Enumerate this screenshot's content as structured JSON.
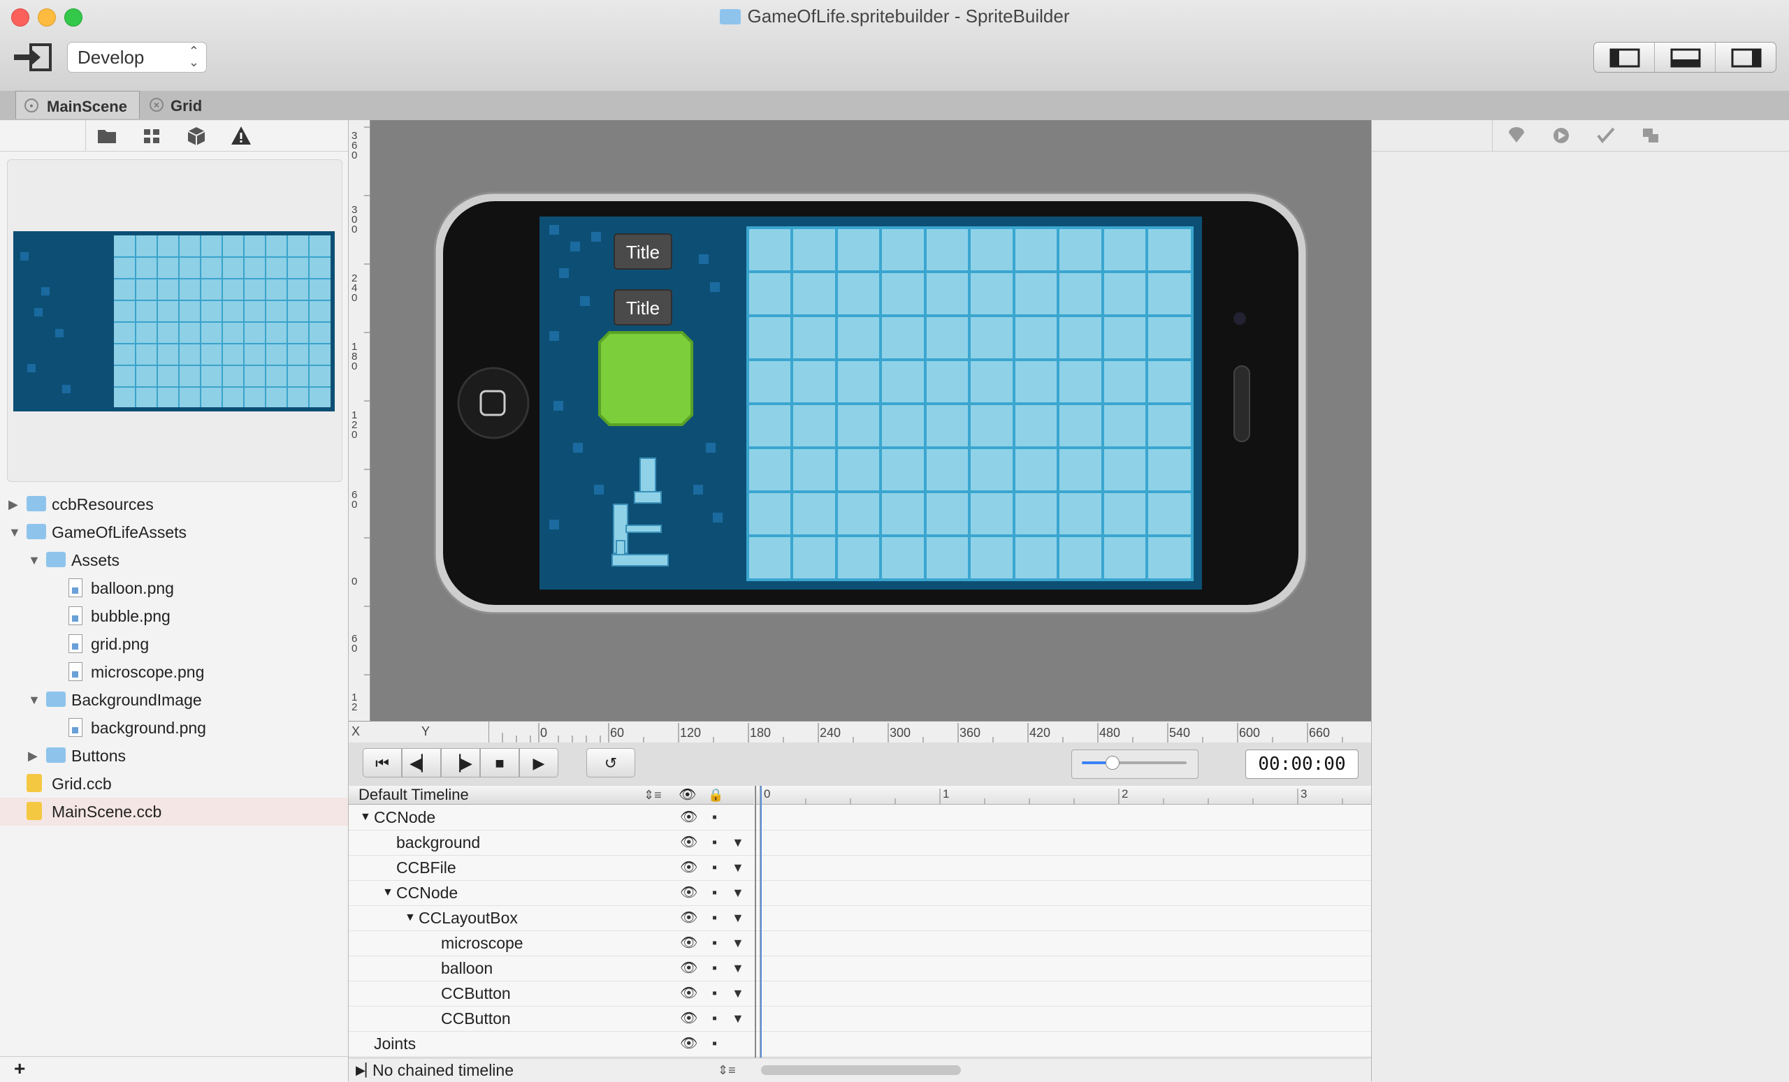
{
  "window": {
    "title": "GameOfLife.spritebuilder - SpriteBuilder"
  },
  "toolbar": {
    "mode_select": "Develop",
    "view_segments": [
      "left-panel-toggle",
      "bottom-panel-toggle",
      "right-panel-toggle"
    ]
  },
  "tabs": [
    {
      "label": "MainScene"
    },
    {
      "label": "Grid"
    }
  ],
  "left_toolbar_icons": [
    "folder-icon",
    "grid-icon",
    "cube-icon",
    "warning-icon"
  ],
  "file_tree": [
    {
      "label": "ccbResources",
      "type": "folder",
      "expanded": false,
      "depth": 0
    },
    {
      "label": "GameOfLifeAssets",
      "type": "folder",
      "expanded": true,
      "depth": 0
    },
    {
      "label": "Assets",
      "type": "folder",
      "expanded": true,
      "depth": 1
    },
    {
      "label": "balloon.png",
      "type": "image",
      "depth": 2
    },
    {
      "label": "bubble.png",
      "type": "image",
      "depth": 2
    },
    {
      "label": "grid.png",
      "type": "image",
      "depth": 2
    },
    {
      "label": "microscope.png",
      "type": "image",
      "depth": 2
    },
    {
      "label": "BackgroundImage",
      "type": "folder",
      "expanded": true,
      "depth": 1
    },
    {
      "label": "background.png",
      "type": "image",
      "depth": 2
    },
    {
      "label": "Buttons",
      "type": "folder",
      "expanded": false,
      "depth": 1
    },
    {
      "label": "Grid.ccb",
      "type": "ccb",
      "depth": 0
    },
    {
      "label": "MainScene.ccb",
      "type": "ccb",
      "depth": 0,
      "selected": true
    }
  ],
  "left_bottom": {
    "add_label": "+"
  },
  "canvas": {
    "buttons": [
      "Title",
      "Title"
    ],
    "vruler_labels": [
      "360",
      "300",
      "240",
      "180",
      "120",
      "60",
      "0",
      "60",
      "12"
    ],
    "hruler_x": "X",
    "hruler_y": "Y",
    "hruler_labels": [
      "0",
      "60",
      "120",
      "180",
      "240",
      "300",
      "360",
      "420",
      "480",
      "540",
      "600",
      "660"
    ]
  },
  "playback": {
    "buttons": [
      "go-to-start",
      "step-back",
      "step-forward",
      "stop",
      "play",
      "loop"
    ],
    "time": "00:00:00"
  },
  "timeline": {
    "name": "Default Timeline",
    "scale_labels": [
      "0",
      "1",
      "2",
      "3"
    ],
    "rows": [
      {
        "label": "CCNode",
        "indent": 0,
        "expanded": true,
        "has_menu": false
      },
      {
        "label": "background",
        "indent": 1,
        "has_menu": true
      },
      {
        "label": "CCBFile",
        "indent": 1,
        "has_menu": true
      },
      {
        "label": "CCNode",
        "indent": 1,
        "expanded": true,
        "has_menu": true
      },
      {
        "label": "CCLayoutBox",
        "indent": 2,
        "expanded": true,
        "has_menu": true
      },
      {
        "label": "microscope",
        "indent": 3,
        "has_menu": true
      },
      {
        "label": "balloon",
        "indent": 3,
        "has_menu": true
      },
      {
        "label": "CCButton",
        "indent": 3,
        "has_menu": true
      },
      {
        "label": "CCButton",
        "indent": 3,
        "has_menu": true
      },
      {
        "label": "Joints",
        "indent": 0,
        "has_menu": false
      }
    ],
    "chained": "No chained timeline"
  },
  "right_toolbar_icons": [
    "properties-icon",
    "code-connections-icon",
    "physics-icon",
    "templates-icon"
  ],
  "colors": {
    "accent": "#1a6fd1",
    "canvas_bg": "#808080",
    "selected_row": "#f4e6e4"
  }
}
